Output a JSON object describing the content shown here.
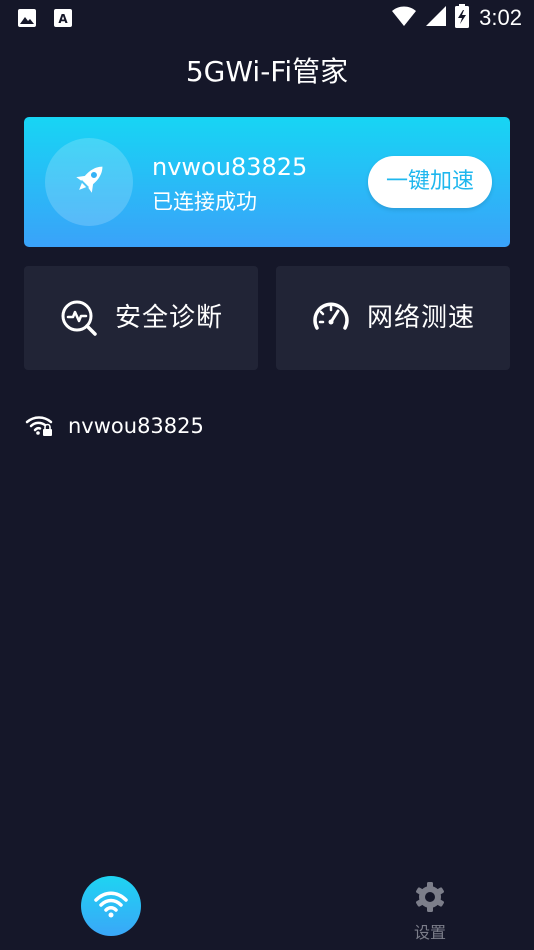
{
  "status_bar": {
    "time": "3:02",
    "icons": [
      "image-icon",
      "font-icon",
      "wifi-signal-icon",
      "cell-signal-icon",
      "battery-charging-icon"
    ]
  },
  "header": {
    "title": "5GWi-Fi管家"
  },
  "connection_card": {
    "ssid": "nvwou83825",
    "status": "已连接成功",
    "boost_label": "一键加速",
    "icon": "rocket-icon"
  },
  "tiles": [
    {
      "label": "安全诊断",
      "icon": "security-diagnosis-icon"
    },
    {
      "label": "网络测速",
      "icon": "speedometer-icon"
    }
  ],
  "wifi_list": [
    {
      "ssid": "nvwou83825",
      "icon": "wifi-lock-icon"
    }
  ],
  "bottom_nav": {
    "wifi_icon": "wifi-icon",
    "settings_label": "设置",
    "settings_icon": "gear-icon"
  },
  "colors": {
    "background": "#151729",
    "tile": "#212436",
    "accent_top": "#17d5f4",
    "accent_bottom": "#3aa2f9",
    "boost_text": "#1fb7ee",
    "muted": "#7c7e8a"
  }
}
